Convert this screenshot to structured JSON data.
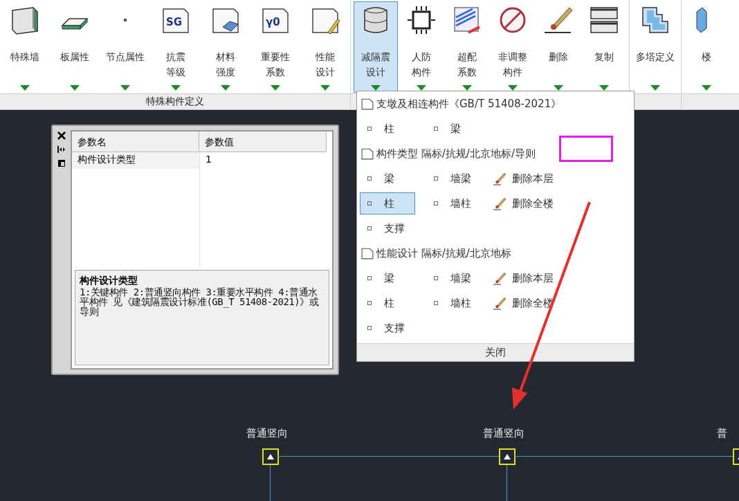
{
  "ribbon": {
    "groups": [
      {
        "label": "特殊构件定义",
        "buttons": [
          {
            "lines": [
              "特殊墙"
            ],
            "selected": false
          },
          {
            "lines": [
              "板属性"
            ],
            "selected": false
          },
          {
            "lines": [
              "节点属性"
            ],
            "selected": false
          },
          {
            "lines": [
              "抗震",
              "等级"
            ],
            "icon_text": "SG",
            "selected": false
          },
          {
            "lines": [
              "材料",
              "强度"
            ],
            "selected": false
          },
          {
            "lines": [
              "重要性",
              "系数"
            ],
            "icon_text": "γ0",
            "selected": false
          },
          {
            "lines": [
              "性能",
              "设计"
            ],
            "selected": false
          }
        ]
      },
      {
        "buttons": [
          {
            "lines": [
              "减隔震",
              "设计"
            ],
            "selected": true
          },
          {
            "lines": [
              "人防",
              "构件"
            ],
            "selected": false
          },
          {
            "lines": [
              "超配",
              "系数"
            ],
            "selected": false
          },
          {
            "lines": [
              "非调整",
              "构件"
            ],
            "selected": false
          },
          {
            "lines": [
              "删除"
            ],
            "selected": false
          },
          {
            "lines": [
              "复制"
            ],
            "selected": false
          }
        ]
      },
      {
        "buttons": [
          {
            "lines": [
              "多塔定义"
            ],
            "selected": false
          }
        ]
      },
      {
        "buttons": [
          {
            "lines": [
              "楼"
            ],
            "selected": false
          }
        ]
      }
    ]
  },
  "menu": {
    "sections": [
      {
        "title": "支墩及相连构件《GB/T 51408-2021》",
        "rows": [
          [
            {
              "kind": "option",
              "label": "柱",
              "selected": false
            },
            {
              "kind": "option",
              "label": "梁",
              "selected": false
            }
          ]
        ]
      },
      {
        "title": "构件类型 隔标/抗规/北京地标/导则",
        "rows": [
          [
            {
              "kind": "option",
              "label": "梁",
              "selected": false
            },
            {
              "kind": "option",
              "label": "墙梁",
              "selected": false
            },
            {
              "kind": "delete",
              "label": "删除本层"
            }
          ],
          [
            {
              "kind": "option",
              "label": "柱",
              "selected": true
            },
            {
              "kind": "option",
              "label": "墙柱",
              "selected": false
            },
            {
              "kind": "delete",
              "label": "删除全楼"
            }
          ],
          [
            {
              "kind": "option",
              "label": "支撑",
              "selected": false
            }
          ]
        ]
      },
      {
        "title": "性能设计 隔标/抗规/北京地标",
        "rows": [
          [
            {
              "kind": "option",
              "label": "梁",
              "selected": false
            },
            {
              "kind": "option",
              "label": "墙梁",
              "selected": false
            },
            {
              "kind": "delete",
              "label": "删除本层"
            }
          ],
          [
            {
              "kind": "option",
              "label": "柱",
              "selected": false
            },
            {
              "kind": "option",
              "label": "墙柱",
              "selected": false
            },
            {
              "kind": "delete",
              "label": "删除全楼"
            }
          ],
          [
            {
              "kind": "option",
              "label": "支撑",
              "selected": false
            }
          ]
        ]
      }
    ],
    "close": "关闭"
  },
  "panel": {
    "columns": [
      "参数名",
      "参数值"
    ],
    "rows": [
      {
        "name": "构件设计类型",
        "value": "1"
      }
    ],
    "description": {
      "title": "构件设计类型",
      "text": "1:关键构件 2:普通竖向构件 3:重要水平构件 4:普通水平构件 见《建筑隔震设计标准(GB_T 51408-2021)》或导则"
    }
  },
  "canvas": {
    "nodes": [
      {
        "label": "普通竖向"
      },
      {
        "label": "普通竖向"
      },
      {
        "label": "普"
      }
    ]
  }
}
